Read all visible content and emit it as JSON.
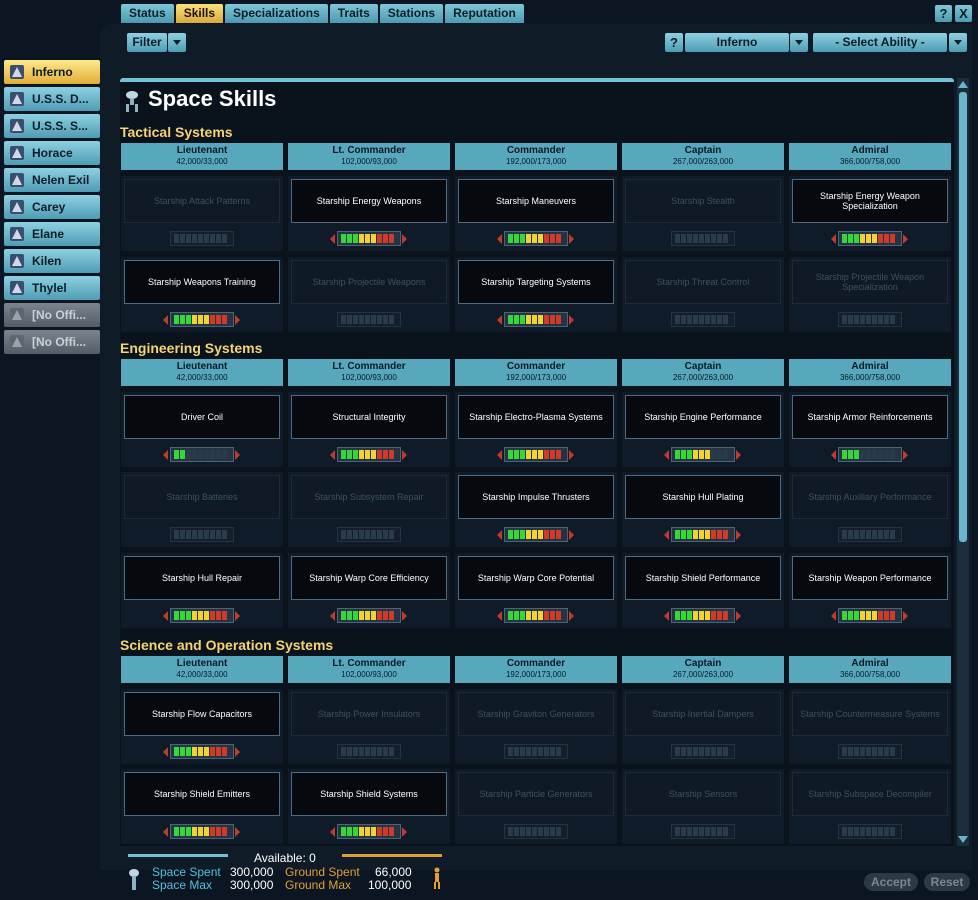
{
  "tabs": [
    "Status",
    "Skills",
    "Specializations",
    "Traits",
    "Stations",
    "Reputation"
  ],
  "active_tab": "Skills",
  "window": {
    "help": "?",
    "close": "X"
  },
  "officers": [
    {
      "name": "Inferno",
      "active": true,
      "empty": false
    },
    {
      "name": "U.S.S. D...",
      "active": false,
      "empty": false
    },
    {
      "name": "U.S.S. S...",
      "active": false,
      "empty": false
    },
    {
      "name": "Horace",
      "active": false,
      "empty": false
    },
    {
      "name": "Nelen Exil",
      "active": false,
      "empty": false
    },
    {
      "name": "Carey",
      "active": false,
      "empty": false
    },
    {
      "name": "Elane",
      "active": false,
      "empty": false
    },
    {
      "name": "Kilen",
      "active": false,
      "empty": false
    },
    {
      "name": "Thylel",
      "active": false,
      "empty": false
    },
    {
      "name": "[No Offi...",
      "active": false,
      "empty": true
    },
    {
      "name": "[No Offi...",
      "active": false,
      "empty": true
    }
  ],
  "toolbar": {
    "filter": "Filter",
    "help": "?",
    "character": "Inferno",
    "ability": "- Select Ability -"
  },
  "page_title": "Space Skills",
  "ranks": [
    {
      "name": "Lieutenant",
      "points": "42,000/33,000"
    },
    {
      "name": "Lt. Commander",
      "points": "102,000/93,000"
    },
    {
      "name": "Commander",
      "points": "192,000/173,000"
    },
    {
      "name": "Captain",
      "points": "267,000/263,000"
    },
    {
      "name": "Admiral",
      "points": "366,000/758,000"
    }
  ],
  "sections": [
    {
      "title": "Tactical Systems",
      "rows": [
        [
          {
            "label": "Starship Attack Patterns",
            "dim": true,
            "level": 0
          },
          {
            "label": "Starship Energy Weapons",
            "dim": false,
            "level": 9
          },
          {
            "label": "Starship Maneuvers",
            "dim": false,
            "level": 9
          },
          {
            "label": "Starship Stealth",
            "dim": true,
            "level": 0
          },
          {
            "label": "Starship Energy Weapon Specialization",
            "dim": false,
            "level": 9
          }
        ],
        [
          {
            "label": "Starship Weapons Training",
            "dim": false,
            "level": 9
          },
          {
            "label": "Starship Projectile Weapons",
            "dim": true,
            "level": 0
          },
          {
            "label": "Starship Targeting Systems",
            "dim": false,
            "level": 9
          },
          {
            "label": "Starship Threat Control",
            "dim": true,
            "level": 0
          },
          {
            "label": "Starship Projectile Weapon Specialization",
            "dim": true,
            "level": 0
          }
        ]
      ]
    },
    {
      "title": "Engineering Systems",
      "rows": [
        [
          {
            "label": "Driver Coil",
            "dim": false,
            "level": 2
          },
          {
            "label": "Structural Integrity",
            "dim": false,
            "level": 9
          },
          {
            "label": "Starship Electro-Plasma Systems",
            "dim": false,
            "level": 9
          },
          {
            "label": "Starship Engine Performance",
            "dim": false,
            "level": 6
          },
          {
            "label": "Starship Armor Reinforcements",
            "dim": false,
            "level": 3
          }
        ],
        [
          {
            "label": "Starship Batteries",
            "dim": true,
            "level": 0
          },
          {
            "label": "Starship Subsystem Repair",
            "dim": true,
            "level": 0
          },
          {
            "label": "Starship Impulse Thrusters",
            "dim": false,
            "level": 9
          },
          {
            "label": "Starship Hull Plating",
            "dim": false,
            "level": 9
          },
          {
            "label": "Starship Auxiliary Performance",
            "dim": true,
            "level": 0
          }
        ],
        [
          {
            "label": "Starship Hull Repair",
            "dim": false,
            "level": 9
          },
          {
            "label": "Starship Warp Core Efficiency",
            "dim": false,
            "level": 9
          },
          {
            "label": "Starship Warp Core Potential",
            "dim": false,
            "level": 9
          },
          {
            "label": "Starship Shield Performance",
            "dim": false,
            "level": 9
          },
          {
            "label": "Starship Weapon Performance",
            "dim": false,
            "level": 9
          }
        ]
      ]
    },
    {
      "title": "Science and Operation Systems",
      "rows": [
        [
          {
            "label": "Starship Flow Capacitors",
            "dim": false,
            "level": 9
          },
          {
            "label": "Starship Power Insulators",
            "dim": true,
            "level": 0
          },
          {
            "label": "Starship Graviton Generators",
            "dim": true,
            "level": 0
          },
          {
            "label": "Starship Inertial Dampers",
            "dim": true,
            "level": 0
          },
          {
            "label": "Starship Countermeasure Systems",
            "dim": true,
            "level": 0
          }
        ],
        [
          {
            "label": "Starship Shield Emitters",
            "dim": false,
            "level": 9
          },
          {
            "label": "Starship Shield Systems",
            "dim": false,
            "level": 9
          },
          {
            "label": "Starship Particle Generators",
            "dim": true,
            "level": 0
          },
          {
            "label": "Starship Sensors",
            "dim": true,
            "level": 0
          },
          {
            "label": "Starship Subspace Decompiler",
            "dim": true,
            "level": 0
          }
        ]
      ]
    }
  ],
  "footer": {
    "available_label": "Available:",
    "available_value": "0",
    "space_spent_label": "Space Spent",
    "space_spent_value": "300,000",
    "space_max_label": "Space Max",
    "space_max_value": "300,000",
    "ground_spent_label": "Ground Spent",
    "ground_spent_value": "66,000",
    "ground_max_label": "Ground Max",
    "ground_max_value": "100,000"
  },
  "buttons": {
    "accept": "Accept",
    "reset": "Reset"
  },
  "colors": {
    "accent_gold": "#f4d473",
    "accent_cyan": "#58a8bd",
    "meter_green": "#35d838",
    "meter_yellow": "#f2d330",
    "meter_red": "#d03a28"
  }
}
